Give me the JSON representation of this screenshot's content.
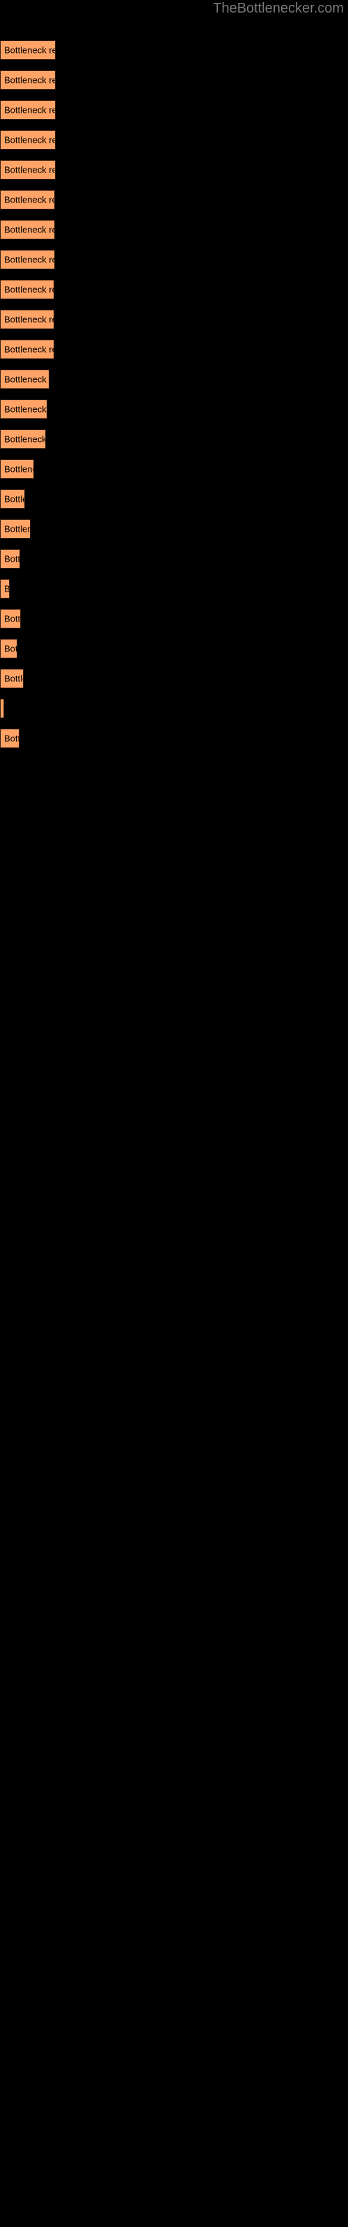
{
  "site": {
    "title": "TheBottlenecker.com",
    "title_color": "#7a7a7a"
  },
  "chart_data": {
    "type": "bar",
    "orientation": "horizontal",
    "title": "",
    "xlabel": "",
    "ylabel": "",
    "grid": false,
    "legend": null,
    "bar_color": "#FFA366",
    "bar_border_color": "#3a2012",
    "background": "#000000",
    "label_color": "#000000",
    "xlim": [
      0,
      500
    ],
    "categories": [
      "Bottleneck result",
      "Bottleneck result",
      "Bottleneck result",
      "Bottleneck result",
      "Bottleneck result",
      "Bottleneck result",
      "Bottleneck result",
      "Bottleneck result",
      "Bottleneck result",
      "Bottleneck result",
      "Bottleneck result",
      "Bottleneck result",
      "Bottleneck result",
      "Bottleneck result",
      "Bottleneck result",
      "Bottleneck result",
      "Bottleneck result",
      "Bottleneck result",
      "Bottleneck result",
      "Bottleneck result",
      "Bottleneck result",
      "Bottleneck result",
      "Bottleneck result"
    ],
    "values": [
      80,
      80,
      80,
      80,
      80,
      80,
      79,
      79,
      79,
      78,
      78,
      66,
      64,
      60,
      48,
      36,
      43,
      28,
      14,
      29,
      25,
      33,
      5,
      28
    ],
    "bars": [
      {
        "label": "Bottleneck result",
        "width": 80,
        "top": 58
      },
      {
        "label": "Bottleneck result",
        "width": 80,
        "top": 101
      },
      {
        "label": "Bottleneck result",
        "width": 80,
        "top": 144
      },
      {
        "label": "Bottleneck result",
        "width": 80,
        "top": 187
      },
      {
        "label": "Bottleneck result",
        "width": 80,
        "top": 230
      },
      {
        "label": "Bottleneck result",
        "width": 79,
        "top": 273
      },
      {
        "label": "Bottleneck result",
        "width": 79,
        "top": 316
      },
      {
        "label": "Bottleneck result",
        "width": 79,
        "top": 359
      },
      {
        "label": "Bottleneck result",
        "width": 78,
        "top": 402
      },
      {
        "label": "Bottleneck result",
        "width": 78,
        "top": 445
      },
      {
        "label": "Bottleneck result",
        "width": 78,
        "top": 488
      },
      {
        "label": "Bottleneck result",
        "width": 71,
        "top": 531
      },
      {
        "label": "Bottleneck result",
        "width": 68,
        "top": 574
      },
      {
        "label": "Bottleneck result",
        "width": 66,
        "top": 617
      },
      {
        "label": "Bottleneck result",
        "width": 49,
        "top": 660
      },
      {
        "label": "Bottleneck result",
        "width": 36,
        "top": 703
      },
      {
        "label": "Bottleneck result",
        "width": 44,
        "top": 746
      },
      {
        "label": "Bottleneck result",
        "width": 29,
        "top": 789
      },
      {
        "label": "Bottleneck result",
        "width": 14,
        "top": 832
      },
      {
        "label": "Bottleneck result",
        "width": 30,
        "top": 875
      },
      {
        "label": "Bottleneck result",
        "width": 25,
        "top": 918
      },
      {
        "label": "Bottleneck result",
        "width": 34,
        "top": 961
      },
      {
        "label": "Bottleneck result",
        "width": 6,
        "top": 1004
      },
      {
        "label": "Bottleneck result",
        "width": 28,
        "top": 1047
      }
    ]
  }
}
